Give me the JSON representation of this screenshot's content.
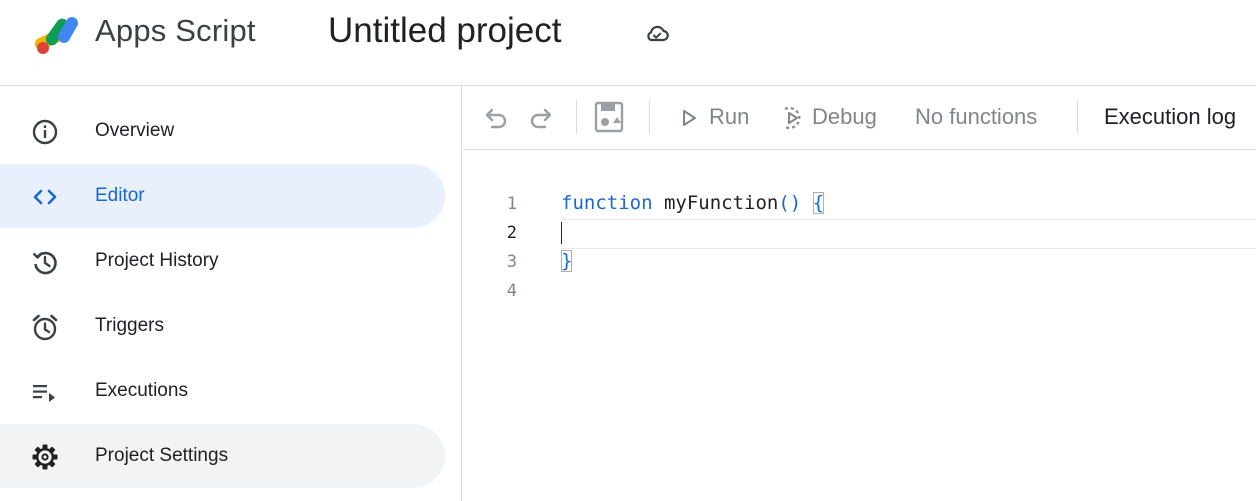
{
  "header": {
    "app_name": "Apps Script",
    "project_title": "Untitled project"
  },
  "sidebar": {
    "items": [
      {
        "label": "Overview",
        "icon": "info-icon",
        "active": false
      },
      {
        "label": "Editor",
        "icon": "code-icon",
        "active": true
      },
      {
        "label": "Project History",
        "icon": "history-icon",
        "active": false
      },
      {
        "label": "Triggers",
        "icon": "alarm-icon",
        "active": false
      },
      {
        "label": "Executions",
        "icon": "executions-list-icon",
        "active": false
      },
      {
        "label": "Project Settings",
        "icon": "gear-icon",
        "active": false
      }
    ]
  },
  "toolbar": {
    "undo_icon": "undo-icon",
    "redo_icon": "redo-icon",
    "save_icon": "save-drive-icon",
    "run_label": "Run",
    "debug_label": "Debug",
    "function_select": "No functions",
    "execution_log_label": "Execution log"
  },
  "editor": {
    "line_numbers": [
      "1",
      "2",
      "3",
      "4"
    ],
    "current_line": 2,
    "code": {
      "keyword": "function",
      "function_name": "myFunction",
      "parens": "()",
      "open_brace": "{",
      "close_brace": "}"
    }
  },
  "colors": {
    "accent": "#1967d2",
    "active_bg": "#e8f0fe",
    "hover_bg": "#f1f3f4",
    "muted": "#80868b",
    "border": "#dadce0"
  }
}
